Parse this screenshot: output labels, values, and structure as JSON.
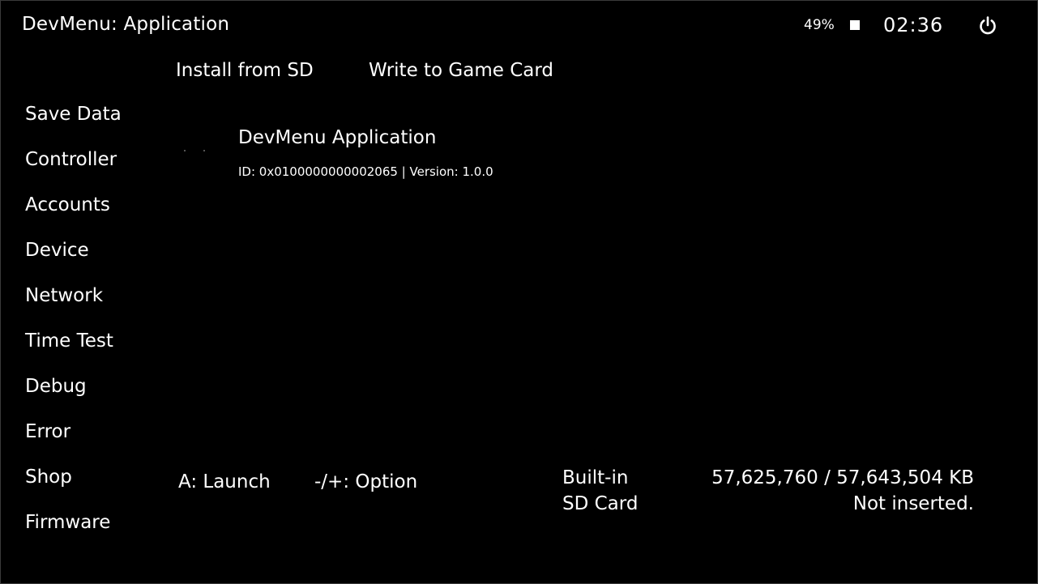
{
  "header": {
    "title": "DevMenu: Application",
    "battery_percent": "49%",
    "battery_icon": "battery-icon",
    "clock": "02:36",
    "power_icon": "power-icon"
  },
  "tabs": [
    {
      "label": "Install from SD"
    },
    {
      "label": "Write to Game Card"
    }
  ],
  "sidebar": {
    "items": [
      {
        "label": "Save Data"
      },
      {
        "label": "Controller"
      },
      {
        "label": "Accounts"
      },
      {
        "label": "Device"
      },
      {
        "label": "Network"
      },
      {
        "label": "Time Test"
      },
      {
        "label": "Debug"
      },
      {
        "label": "Error"
      },
      {
        "label": "Shop"
      },
      {
        "label": "Firmware"
      }
    ]
  },
  "applications": [
    {
      "name": "DevMenu Application",
      "meta": "ID: 0x0100000000002065 | Version: 1.0.0"
    }
  ],
  "hints": {
    "launch": "A: Launch",
    "option": "-/+: Option"
  },
  "storage": [
    {
      "label": "Built-in",
      "value": "57,625,760 / 57,643,504 KB"
    },
    {
      "label": "SD Card",
      "value": "Not inserted."
    }
  ],
  "colors": {
    "background": "#000000",
    "text": "#ffffff"
  }
}
